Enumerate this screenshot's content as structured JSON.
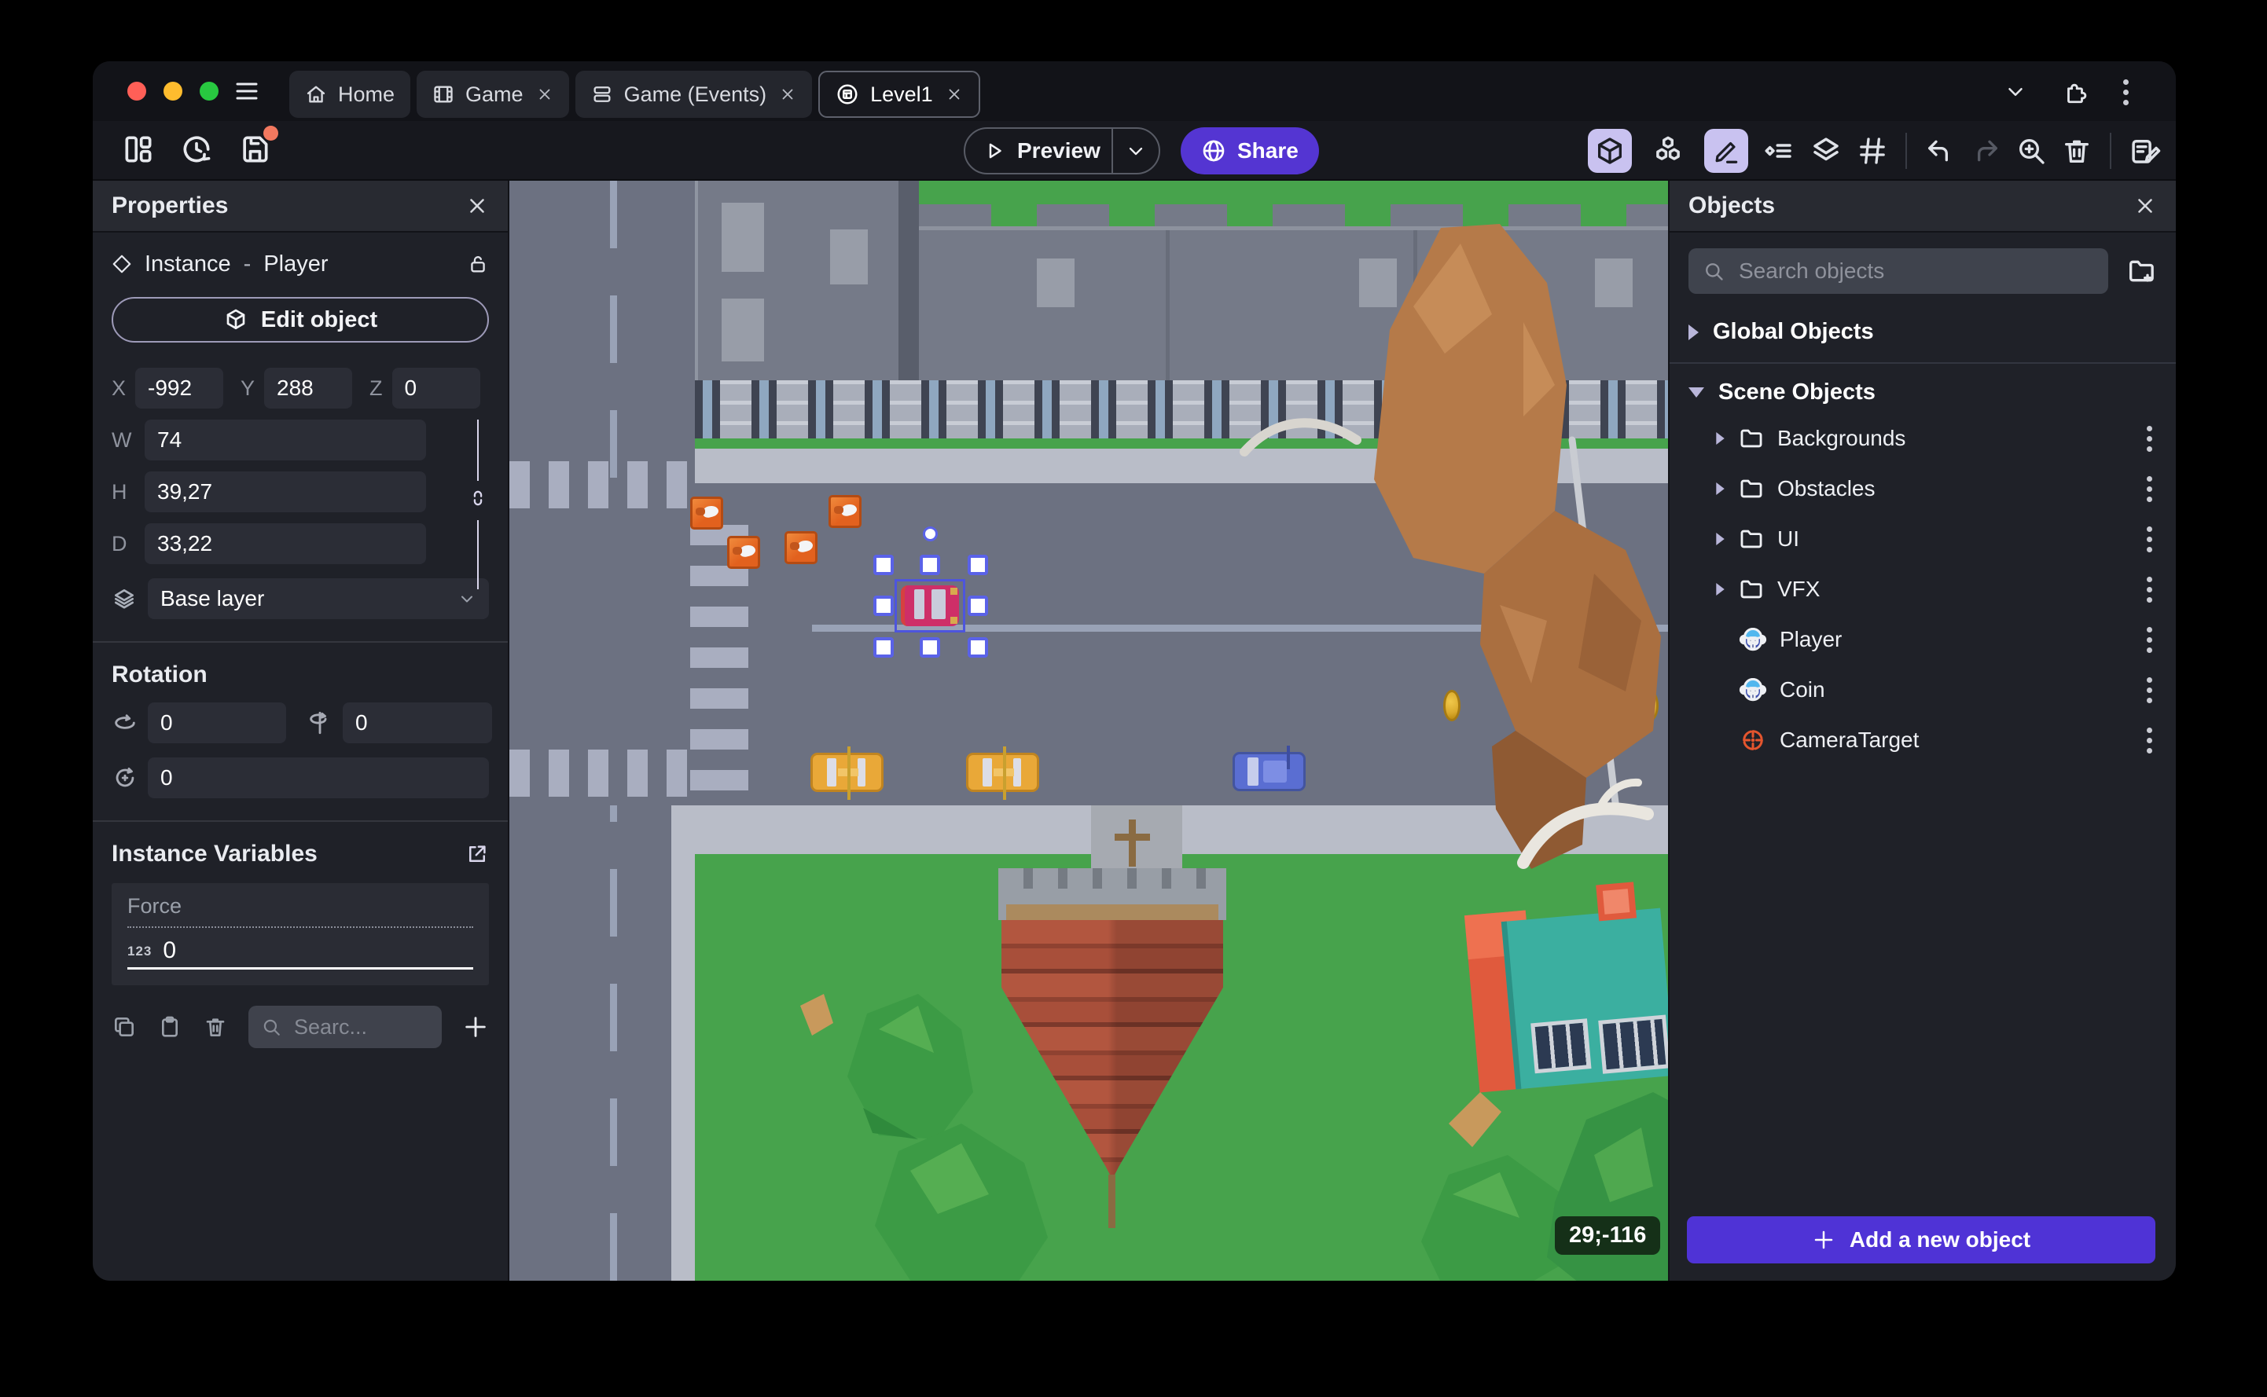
{
  "colors": {
    "accent_purple": "#5435d2",
    "add_button_purple": "#4f33d6",
    "toolbar_highlight": "#c9c2f0",
    "unsaved_dot": "#f2785f",
    "selection_blue": "#5a62e8",
    "traffic_lights": [
      "#ff5f57",
      "#febc2e",
      "#28c840"
    ],
    "grass_green": "#47a34c",
    "road_gray": "#6c7181"
  },
  "titlebar": {
    "tabs": [
      {
        "label": "Home",
        "icon": "home-icon",
        "closable": false,
        "active": false
      },
      {
        "label": "Game",
        "icon": "film-icon",
        "closable": true,
        "active": false
      },
      {
        "label": "Game (Events)",
        "icon": "events-icon",
        "closable": true,
        "active": false
      },
      {
        "label": "Level1",
        "icon": "scene-icon",
        "closable": true,
        "active": true
      }
    ]
  },
  "toolbar": {
    "preview_label": "Preview",
    "share_label": "Share"
  },
  "properties_panel": {
    "title": "Properties",
    "instance_label": "Instance",
    "separator": "-",
    "object_name": "Player",
    "edit_object_label": "Edit object",
    "position": {
      "x_label": "X",
      "x": "-992",
      "y_label": "Y",
      "y": "288",
      "z_label": "Z",
      "z": "0"
    },
    "size": {
      "w_label": "W",
      "w": "74",
      "h_label": "H",
      "h": "39,27",
      "d_label": "D",
      "d": "33,22"
    },
    "layer": "Base layer",
    "rotation_title": "Rotation",
    "rotation": {
      "x": "0",
      "y": "0",
      "z": "0"
    },
    "variables_title": "Instance Variables",
    "variables": [
      {
        "name": "Force",
        "value": "0"
      }
    ],
    "variables_search_placeholder": "Searc..."
  },
  "objects_panel": {
    "title": "Objects",
    "search_placeholder": "Search objects",
    "global_section": "Global Objects",
    "scene_section": "Scene Objects",
    "rows": [
      {
        "label": "Backgrounds",
        "type": "folder"
      },
      {
        "label": "Obstacles",
        "type": "folder"
      },
      {
        "label": "UI",
        "type": "folder"
      },
      {
        "label": "VFX",
        "type": "folder"
      },
      {
        "label": "Player",
        "type": "object"
      },
      {
        "label": "Coin",
        "type": "object"
      },
      {
        "label": "CameraTarget",
        "type": "camera-target"
      }
    ],
    "add_button_label": "Add a new object"
  },
  "canvas": {
    "coordinates_badge": "29;-116"
  }
}
